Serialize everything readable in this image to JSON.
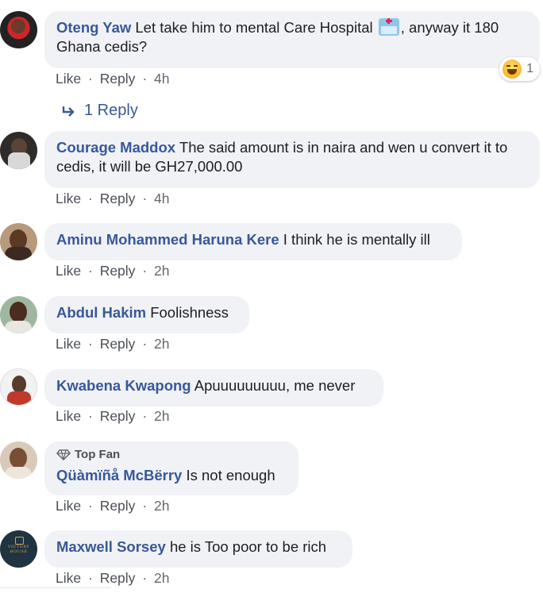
{
  "comments": [
    {
      "author": "Oteng Yaw",
      "text_before": "Let take him to mental Care Hospital",
      "text_after": ", anyway it 180 Ghana cedis?",
      "like": "Like",
      "reply": "Reply",
      "time": "4h",
      "reaction_count": "1",
      "replies_label": "1 Reply"
    },
    {
      "author": "Courage Maddox",
      "text": "The said amount is in naira and wen u convert it to cedis, it will be GH27,000.00",
      "like": "Like",
      "reply": "Reply",
      "time": "4h"
    },
    {
      "author": "Aminu Mohammed Haruna Kere",
      "text": "I think he is mentally ill",
      "like": "Like",
      "reply": "Reply",
      "time": "2h"
    },
    {
      "author": "Abdul Hakim",
      "text": "Foolishness",
      "like": "Like",
      "reply": "Reply",
      "time": "2h"
    },
    {
      "author": "Kwabena Kwapong",
      "text": "Apuuuuuuuuu, me never",
      "like": "Like",
      "reply": "Reply",
      "time": "2h"
    },
    {
      "badge": "Top Fan",
      "author": "Qüàmïñå McBërry",
      "text": "Is not enough",
      "like": "Like",
      "reply": "Reply",
      "time": "2h"
    },
    {
      "author": "Maxwell Sorsey",
      "text": "he is Too poor to be rich",
      "like": "Like",
      "reply": "Reply",
      "time": "2h"
    }
  ],
  "separator": "·",
  "colors": {
    "author": "#385898",
    "bubble": "#f0f2f5",
    "meta": "#65676b"
  }
}
